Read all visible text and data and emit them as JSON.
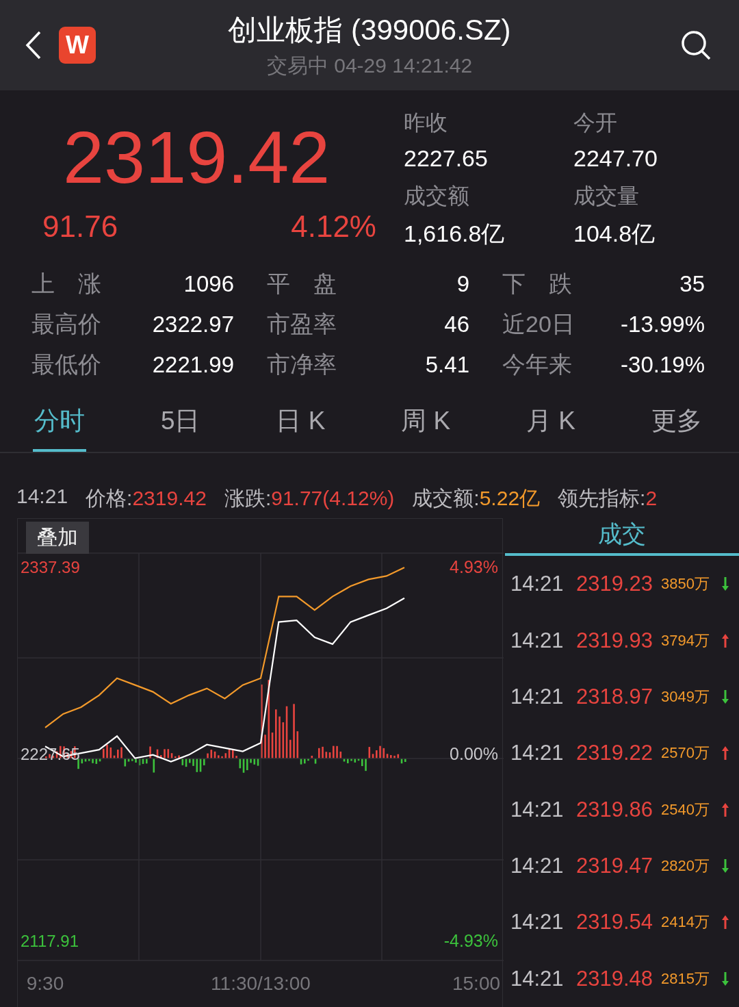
{
  "header": {
    "logo": "W",
    "title": "创业板指 (399006.SZ)",
    "subtitle": "交易中 04-29 14:21:42"
  },
  "quote": {
    "price": "2319.42",
    "change": "91.76",
    "change_pct": "4.12%",
    "fields": [
      {
        "label": "昨收",
        "value": "2227.65"
      },
      {
        "label": "今开",
        "value": "2247.70"
      },
      {
        "label": "成交额",
        "value": "1,616.8亿"
      },
      {
        "label": "成交量",
        "value": "104.8亿"
      }
    ]
  },
  "stats": [
    [
      {
        "label": "上　涨",
        "value": "1096"
      },
      {
        "label": "平　盘",
        "value": "9"
      },
      {
        "label": "下　跌",
        "value": "35"
      }
    ],
    [
      {
        "label": "最高价",
        "value": "2322.97"
      },
      {
        "label": "市盈率",
        "value": "46"
      },
      {
        "label": "近20日",
        "value": "-13.99%"
      }
    ],
    [
      {
        "label": "最低价",
        "value": "2221.99"
      },
      {
        "label": "市净率",
        "value": "5.41"
      },
      {
        "label": "今年来",
        "value": "-30.19%"
      }
    ]
  ],
  "tabs": [
    {
      "label": "分时",
      "selected": true
    },
    {
      "label": "5日",
      "selected": false
    },
    {
      "label": "日 K",
      "selected": false
    },
    {
      "label": "周 K",
      "selected": false
    },
    {
      "label": "月 K",
      "selected": false
    },
    {
      "label": "更多",
      "selected": false
    }
  ],
  "info_bar": {
    "time": "14:21",
    "items": [
      {
        "label": "价格:",
        "value": "2319.42",
        "color": "#e8443f"
      },
      {
        "label": "涨跌:",
        "value": "91.77(4.12%)",
        "color": "#e8443f"
      },
      {
        "label": "成交额:",
        "value": "5.22亿",
        "color": "#f39a2b"
      },
      {
        "label": "领先指标:",
        "value": "2",
        "color": "#e8443f"
      }
    ]
  },
  "chart": {
    "overlay_button": "叠加",
    "right_labels": [
      {
        "label": "4.93%",
        "color": "#e8443f"
      },
      {
        "label": "0.00%",
        "color": "#c9c8cc"
      },
      {
        "label": "-4.93%",
        "color": "#3cc23c"
      }
    ],
    "chart_data": {
      "type": "line",
      "categories": [
        "9:30",
        null,
        null,
        null,
        null,
        null,
        null,
        null,
        null,
        null,
        null,
        null,
        "11:30/13:00",
        null,
        null,
        null,
        null,
        null,
        null,
        null,
        null,
        null,
        null,
        null,
        "15:00"
      ],
      "series": [
        {
          "color": "#ffffff",
          "values": [
            2232,
            2226,
            2228,
            2230,
            2238,
            2225,
            2227,
            2223,
            2227,
            2233,
            2231,
            2229,
            2234,
            2305,
            2306,
            2296,
            2292,
            2305,
            2309,
            2313,
            2319,
            null,
            null,
            null,
            null
          ]
        },
        {
          "color": "#f39a2b",
          "values": [
            2243,
            2251,
            2255,
            2262,
            2272,
            2268,
            2264,
            2257,
            2262,
            2266,
            2260,
            2268,
            2272,
            2320,
            2320,
            2312,
            2320,
            2326,
            2330,
            2332,
            2337,
            null,
            null,
            null,
            null
          ]
        }
      ],
      "ylim": [
        2078.52,
        2365.53
      ],
      "yticks": [
        {
          "value": 2337.39,
          "label": "2337.39"
        },
        {
          "value": 2227.65,
          "label": "2227.65"
        },
        {
          "value": 2117.91,
          "label": "2117.91"
        }
      ]
    }
  },
  "trades": {
    "title": "成交",
    "rows": [
      {
        "time": "14:21",
        "price": "2319.23",
        "volume": "3850万",
        "up": false
      },
      {
        "time": "14:21",
        "price": "2319.93",
        "volume": "3794万",
        "up": true
      },
      {
        "time": "14:21",
        "price": "2318.97",
        "volume": "3049万",
        "up": false
      },
      {
        "time": "14:21",
        "price": "2319.22",
        "volume": "2570万",
        "up": true
      },
      {
        "time": "14:21",
        "price": "2319.86",
        "volume": "2540万",
        "up": true
      },
      {
        "time": "14:21",
        "price": "2319.47",
        "volume": "2820万",
        "up": false
      },
      {
        "time": "14:21",
        "price": "2319.54",
        "volume": "2414万",
        "up": true
      },
      {
        "time": "14:21",
        "price": "2319.48",
        "volume": "2815万",
        "up": false
      }
    ]
  }
}
